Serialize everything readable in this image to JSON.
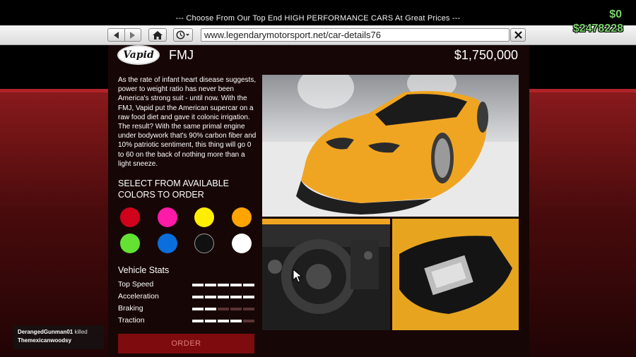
{
  "banner": {
    "text": "--- Choose From Our Top End HIGH PERFORMANCE CARS At Great Prices ---"
  },
  "browser": {
    "url": "www.legendarymotorsport.net/car-details76",
    "icons": [
      "back-arrow-icon",
      "forward-arrow-icon",
      "home-icon",
      "history-clock-icon",
      "close-x-icon"
    ]
  },
  "player": {
    "cash": "$0",
    "bank": "$2478228"
  },
  "car": {
    "brand": "Vapid",
    "model": "FMJ",
    "price": "$1,750,000",
    "description": "As the rate of infant heart disease suggests, power to weight ratio has never been America's strong suit - until now. With the FMJ, Vapid put the American supercar on a raw food diet and gave it colonic irrigation. The result? With the same primal engine under bodywork that's 90% carbon fiber and 10% patriotic sentiment, this thing will go 0 to 60 on the back of nothing more than a light sneeze."
  },
  "colors": {
    "heading": "SELECT FROM AVAILABLE COLORS TO ORDER",
    "swatches": [
      "#d0021b",
      "#ff1aa8",
      "#ffee00",
      "#ffa400",
      "#63e234",
      "#0a6fdc",
      "#101010",
      "#ffffff"
    ]
  },
  "stats": {
    "heading": "Vehicle Stats",
    "items": [
      {
        "label": "Top Speed",
        "level": 0.9
      },
      {
        "label": "Acceleration",
        "level": 0.9
      },
      {
        "label": "Braking",
        "level": 0.4
      },
      {
        "label": "Traction",
        "level": 0.8
      }
    ]
  },
  "order_label": "ORDER",
  "killfeed": {
    "killer": "DerangedGunman01",
    "action": "killed",
    "victim": "Themexicanwoodsy"
  },
  "accent_colors": {
    "brand_red": "#b02327",
    "money_green": "#7bd16b",
    "panel_bg": "#170606"
  }
}
